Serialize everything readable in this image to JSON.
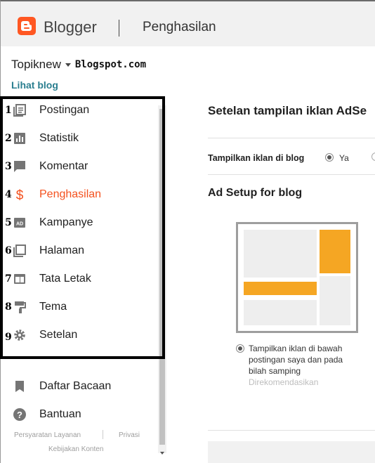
{
  "header": {
    "brand": "Blogger",
    "page_title": "Penghasilan"
  },
  "blog": {
    "name": "Topiknew",
    "domain": "Blogspot.com",
    "view_blog": "Lihat blog"
  },
  "sidebar": {
    "items": [
      {
        "num": "1",
        "label": "Postingan",
        "icon": "posts-icon"
      },
      {
        "num": "2",
        "label": "Statistik",
        "icon": "stats-icon"
      },
      {
        "num": "3",
        "label": "Komentar",
        "icon": "comment-icon"
      },
      {
        "num": "4",
        "label": "Penghasilan",
        "icon": "dollar-icon",
        "active": true
      },
      {
        "num": "5",
        "label": "Kampanye",
        "icon": "ad-icon"
      },
      {
        "num": "6",
        "label": "Halaman",
        "icon": "pages-icon"
      },
      {
        "num": "7",
        "label": "Tata Letak",
        "icon": "layout-icon"
      },
      {
        "num": "8",
        "label": "Tema",
        "icon": "theme-icon"
      },
      {
        "num": "9",
        "label": "Setelan",
        "icon": "gear-icon"
      }
    ],
    "extra": [
      {
        "label": "Daftar Bacaan",
        "icon": "bookmark-icon"
      },
      {
        "label": "Bantuan",
        "icon": "help-icon"
      }
    ],
    "footer": {
      "terms": "Persyaratan Layanan",
      "privacy": "Privasi",
      "content_policy": "Kebijakan Konten"
    }
  },
  "main": {
    "section_title": "Setelan tampilan iklan AdSe",
    "show_ads_label": "Tampilkan iklan di blog",
    "show_ads_yes": "Ya",
    "ad_setup_title": "Ad Setup for blog",
    "option_text": "Tampilkan iklan di bawah postingan saya dan pada bilah samping",
    "option_recommended": "Direkomendasikan"
  },
  "colors": {
    "brand": "#ff5722",
    "active": "#f4511e",
    "link": "#2a7e8f",
    "ad_slot": "#f5a623"
  }
}
